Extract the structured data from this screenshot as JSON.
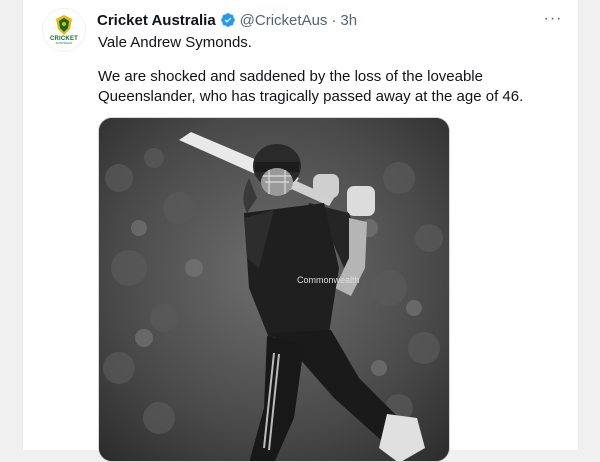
{
  "tweet": {
    "author": {
      "name": "Cricket Australia",
      "handle": "@CricketAus",
      "verified": true,
      "avatar_text": "CRICKET",
      "avatar_subtext": "AUSTRALIA"
    },
    "separator": "·",
    "timestamp": "3h",
    "text_line1": "Vale Andrew Symonds.",
    "text_line2": "We are shocked and saddened by the loss of the loveable Queenslander, who has tragically passed away at the age of 46.",
    "more_icon": "···",
    "media": {
      "style": "black-and-white photo",
      "shirt_text": "Commonwealth"
    }
  },
  "colors": {
    "primary_text": "#0f1419",
    "secondary_text": "#536471",
    "verified_blue": "#1d9bf0",
    "background": "#f0f0f0"
  },
  "icons": [
    "verified-badge-icon",
    "more-options-icon"
  ]
}
